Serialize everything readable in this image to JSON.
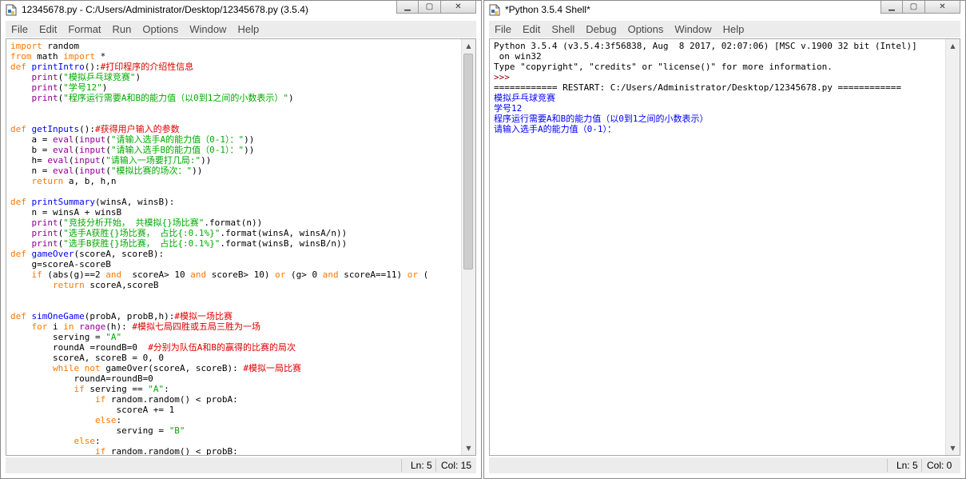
{
  "editor": {
    "title": "12345678.py - C:/Users/Administrator/Desktop/12345678.py (3.5.4)",
    "menu": [
      "File",
      "Edit",
      "Format",
      "Run",
      "Options",
      "Window",
      "Help"
    ],
    "status": {
      "ln": "Ln: 5",
      "col": "Col: 15"
    },
    "code_lines": [
      [
        {
          "t": "import",
          "c": "kw"
        },
        {
          "t": " random"
        }
      ],
      [
        {
          "t": "from",
          "c": "kw"
        },
        {
          "t": " math "
        },
        {
          "t": "import",
          "c": "kw"
        },
        {
          "t": " *"
        }
      ],
      [
        {
          "t": "def",
          "c": "kw"
        },
        {
          "t": " "
        },
        {
          "t": "printIntro",
          "c": "fn"
        },
        {
          "t": "():"
        },
        {
          "t": "#打印程序的介绍性信息",
          "c": "cm"
        }
      ],
      [
        {
          "t": "    "
        },
        {
          "t": "print",
          "c": "bi"
        },
        {
          "t": "("
        },
        {
          "t": "\"模拟乒乓球竞赛\"",
          "c": "st"
        },
        {
          "t": ")"
        }
      ],
      [
        {
          "t": "    "
        },
        {
          "t": "print",
          "c": "bi"
        },
        {
          "t": "("
        },
        {
          "t": "\"学号12\"",
          "c": "st"
        },
        {
          "t": ")"
        }
      ],
      [
        {
          "t": "    "
        },
        {
          "t": "print",
          "c": "bi"
        },
        {
          "t": "("
        },
        {
          "t": "\"程序运行需要A和B的能力值（以0到1之间的小数表示）\"",
          "c": "st"
        },
        {
          "t": ")"
        }
      ],
      [],
      [],
      [
        {
          "t": "def",
          "c": "kw"
        },
        {
          "t": " "
        },
        {
          "t": "getInputs",
          "c": "fn"
        },
        {
          "t": "():"
        },
        {
          "t": "#获得用户输入的参数",
          "c": "cm"
        }
      ],
      [
        {
          "t": "    a = "
        },
        {
          "t": "eval",
          "c": "bi"
        },
        {
          "t": "("
        },
        {
          "t": "input",
          "c": "bi"
        },
        {
          "t": "("
        },
        {
          "t": "\"请输入选手A的能力值（0-1）：\"",
          "c": "st"
        },
        {
          "t": "))"
        }
      ],
      [
        {
          "t": "    b = "
        },
        {
          "t": "eval",
          "c": "bi"
        },
        {
          "t": "("
        },
        {
          "t": "input",
          "c": "bi"
        },
        {
          "t": "("
        },
        {
          "t": "\"请输入选手B的能力值（0-1）：\"",
          "c": "st"
        },
        {
          "t": "))"
        }
      ],
      [
        {
          "t": "    h= "
        },
        {
          "t": "eval",
          "c": "bi"
        },
        {
          "t": "("
        },
        {
          "t": "input",
          "c": "bi"
        },
        {
          "t": "("
        },
        {
          "t": "\"请输入一场要打几局:\"",
          "c": "st"
        },
        {
          "t": "))"
        }
      ],
      [
        {
          "t": "    n = "
        },
        {
          "t": "eval",
          "c": "bi"
        },
        {
          "t": "("
        },
        {
          "t": "input",
          "c": "bi"
        },
        {
          "t": "("
        },
        {
          "t": "\"模拟比赛的场次：\"",
          "c": "st"
        },
        {
          "t": "))"
        }
      ],
      [
        {
          "t": "    "
        },
        {
          "t": "return",
          "c": "kw"
        },
        {
          "t": " a, b, h,n"
        }
      ],
      [],
      [
        {
          "t": "def",
          "c": "kw"
        },
        {
          "t": " "
        },
        {
          "t": "printSummary",
          "c": "fn"
        },
        {
          "t": "(winsA, winsB):"
        }
      ],
      [
        {
          "t": "    n = winsA + winsB"
        }
      ],
      [
        {
          "t": "    "
        },
        {
          "t": "print",
          "c": "bi"
        },
        {
          "t": "("
        },
        {
          "t": "\"竞技分析开始， 共模拟{}场比赛\"",
          "c": "st"
        },
        {
          "t": ".format(n))"
        }
      ],
      [
        {
          "t": "    "
        },
        {
          "t": "print",
          "c": "bi"
        },
        {
          "t": "("
        },
        {
          "t": "\"选手A获胜{}场比赛， 占比{:0.1%}\"",
          "c": "st"
        },
        {
          "t": ".format(winsA, winsA/n))"
        }
      ],
      [
        {
          "t": "    "
        },
        {
          "t": "print",
          "c": "bi"
        },
        {
          "t": "("
        },
        {
          "t": "\"选手B获胜{}场比赛， 占比{:0.1%}\"",
          "c": "st"
        },
        {
          "t": ".format(winsB, winsB/n))"
        }
      ],
      [
        {
          "t": "def",
          "c": "kw"
        },
        {
          "t": " "
        },
        {
          "t": "gameOver",
          "c": "fn"
        },
        {
          "t": "(scoreA, scoreB):"
        }
      ],
      [
        {
          "t": "    g=scoreA-scoreB"
        }
      ],
      [
        {
          "t": "    "
        },
        {
          "t": "if",
          "c": "kw"
        },
        {
          "t": " (abs(g)==2 "
        },
        {
          "t": "and",
          "c": "kw"
        },
        {
          "t": "  scoreA> 10 "
        },
        {
          "t": "and",
          "c": "kw"
        },
        {
          "t": " scoreB> 10) "
        },
        {
          "t": "or",
          "c": "kw"
        },
        {
          "t": " (g> 0 "
        },
        {
          "t": "and",
          "c": "kw"
        },
        {
          "t": " scoreA==11) "
        },
        {
          "t": "or",
          "c": "kw"
        },
        {
          "t": " ("
        }
      ],
      [
        {
          "t": "        "
        },
        {
          "t": "return",
          "c": "kw"
        },
        {
          "t": " scoreA,scoreB"
        }
      ],
      [],
      [],
      [
        {
          "t": "def",
          "c": "kw"
        },
        {
          "t": " "
        },
        {
          "t": "simOneGame",
          "c": "fn"
        },
        {
          "t": "(probA, probB,h):"
        },
        {
          "t": "#模拟一场比赛",
          "c": "cm"
        }
      ],
      [
        {
          "t": "    "
        },
        {
          "t": "for",
          "c": "kw"
        },
        {
          "t": " i "
        },
        {
          "t": "in",
          "c": "kw"
        },
        {
          "t": " "
        },
        {
          "t": "range",
          "c": "bi"
        },
        {
          "t": "(h): "
        },
        {
          "t": "#模拟七局四胜或五局三胜为一场",
          "c": "cm"
        }
      ],
      [
        {
          "t": "        serving = "
        },
        {
          "t": "\"A\"",
          "c": "st"
        }
      ],
      [
        {
          "t": "        roundA =roundB=0  "
        },
        {
          "t": "#分别为队伍A和B的赢得的比赛的局次",
          "c": "cm"
        }
      ],
      [
        {
          "t": "        scoreA, scoreB = 0, 0"
        }
      ],
      [
        {
          "t": "        "
        },
        {
          "t": "while",
          "c": "kw"
        },
        {
          "t": " "
        },
        {
          "t": "not",
          "c": "kw"
        },
        {
          "t": " gameOver(scoreA, scoreB): "
        },
        {
          "t": "#模拟一局比赛",
          "c": "cm"
        }
      ],
      [
        {
          "t": "            roundA=roundB=0"
        }
      ],
      [
        {
          "t": "            "
        },
        {
          "t": "if",
          "c": "kw"
        },
        {
          "t": " serving == "
        },
        {
          "t": "\"A\"",
          "c": "st"
        },
        {
          "t": ":"
        }
      ],
      [
        {
          "t": "                "
        },
        {
          "t": "if",
          "c": "kw"
        },
        {
          "t": " random.random() < probA:"
        }
      ],
      [
        {
          "t": "                    scoreA += 1"
        }
      ],
      [
        {
          "t": "                "
        },
        {
          "t": "else",
          "c": "kw"
        },
        {
          "t": ":"
        }
      ],
      [
        {
          "t": "                    serving = "
        },
        {
          "t": "\"B\"",
          "c": "st"
        }
      ],
      [
        {
          "t": "            "
        },
        {
          "t": "else",
          "c": "kw"
        },
        {
          "t": ":"
        }
      ],
      [
        {
          "t": "                "
        },
        {
          "t": "if",
          "c": "kw"
        },
        {
          "t": " random.random() < probB:"
        }
      ]
    ]
  },
  "shell": {
    "title": "*Python 3.5.4 Shell*",
    "menu": [
      "File",
      "Edit",
      "Shell",
      "Debug",
      "Options",
      "Window",
      "Help"
    ],
    "status": {
      "ln": "Ln: 5",
      "col": "Col: 0"
    },
    "lines": [
      [
        {
          "t": "Python 3.5.4 (v3.5.4:3f56838, Aug  8 2017, 02:07:06) [MSC v.1900 32 bit (Intel)]",
          "c": "so"
        }
      ],
      [
        {
          "t": " on win32",
          "c": "so"
        }
      ],
      [
        {
          "t": "Type \"copyright\", \"credits\" or \"license()\" for more information.",
          "c": "so"
        }
      ],
      [
        {
          "t": ">>> ",
          "c": "pr"
        }
      ],
      [
        {
          "t": "============ RESTART: C:/Users/Administrator/Desktop/12345678.py ============",
          "c": "so"
        }
      ],
      [
        {
          "t": "模拟乒乓球竞赛",
          "c": "out"
        }
      ],
      [
        {
          "t": "学号12",
          "c": "out"
        }
      ],
      [
        {
          "t": "程序运行需要A和B的能力值（以0到1之间的小数表示）",
          "c": "out"
        }
      ],
      [
        {
          "t": "请输入选手A的能力值（0-1）：",
          "c": "out"
        }
      ]
    ]
  },
  "icons": {
    "window_icon": "python-file-icon",
    "minimize": "minimize-icon",
    "maximize": "maximize-icon",
    "close": "close-icon"
  }
}
